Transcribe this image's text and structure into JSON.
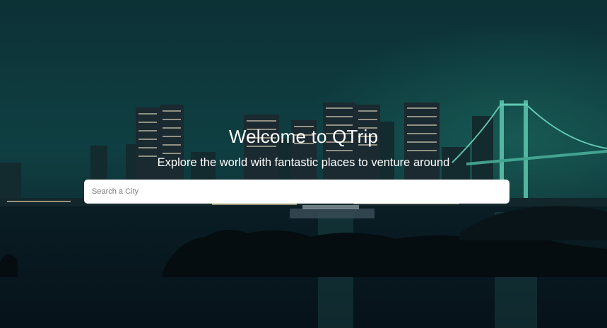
{
  "hero": {
    "title": "Welcome to QTrip",
    "subtitle": "Explore the world with fantastic places to venture around"
  },
  "search": {
    "placeholder": "Search a City",
    "value": ""
  },
  "background": {
    "description_icon": "city-night-skyline-image",
    "sky_color": "#0d3a3a",
    "water_color": "#0b1e26",
    "bridge_color": "#6fe0c4"
  }
}
